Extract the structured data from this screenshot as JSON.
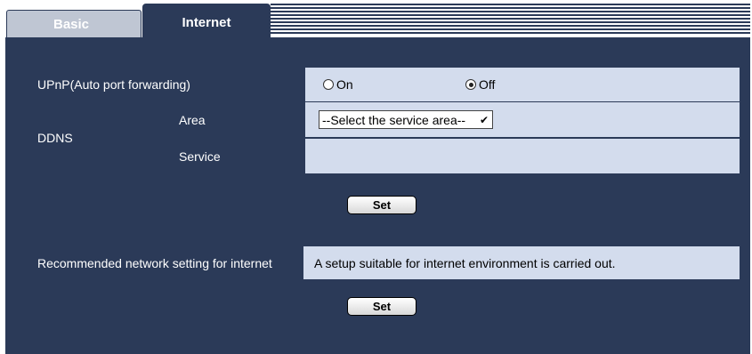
{
  "tabs": [
    {
      "label": "Basic",
      "active": false
    },
    {
      "label": "Internet",
      "active": true
    }
  ],
  "upnp": {
    "label": "UPnP(Auto port forwarding)",
    "options": [
      {
        "label": "On",
        "selected": false
      },
      {
        "label": "Off",
        "selected": true
      }
    ]
  },
  "ddns": {
    "label": "DDNS",
    "area_label": "Area",
    "area_value": "--Select the service area--",
    "service_label": "Service"
  },
  "set_button_label": "Set",
  "recommended": {
    "label": "Recommended network setting for internet",
    "value": "A setup suitable for internet environment is carried out."
  },
  "colors": {
    "panel": "#2b3a58",
    "value_cell": "#d3dced",
    "inactive_tab": "#bfc6d3"
  }
}
